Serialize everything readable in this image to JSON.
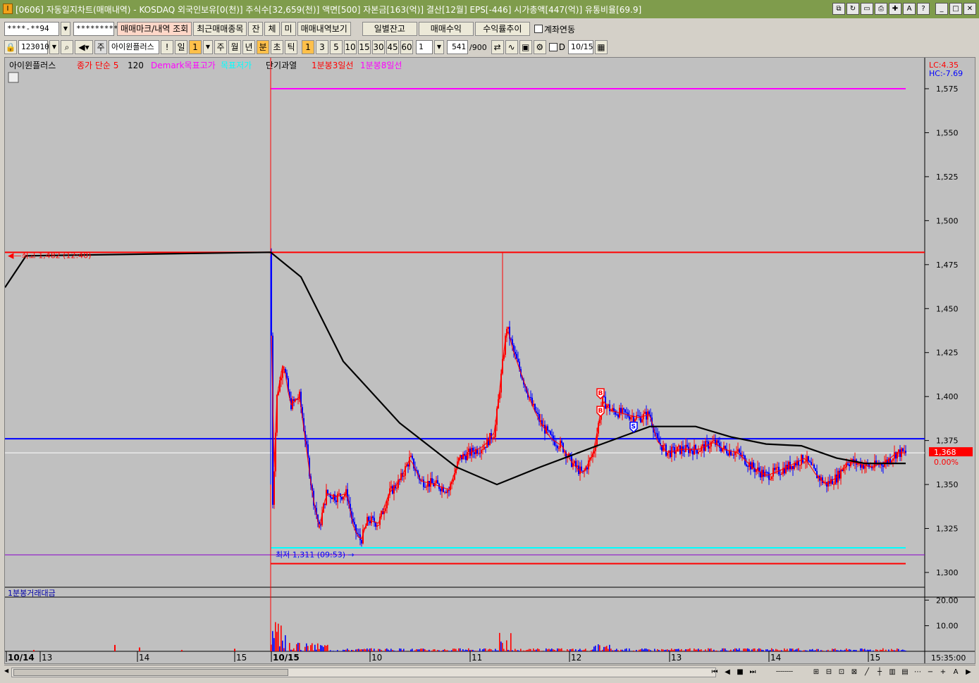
{
  "window": {
    "title": "[0606] 자동일지차트(매매내역) - KOSDAQ 외국인보유[0(천)] 주식수[32,659(천)] 액면[500] 자본금[163(억)] 결산[12월] EPS[-446] 시가총액[447(억)] 유통비율[69.9]",
    "app_icon_label": "I"
  },
  "toolbar1": {
    "account_value": "****-**94",
    "password_value": "*********",
    "buttons": [
      "매매마크/내역 조회",
      "최근매매종목",
      "잔",
      "체",
      "미",
      "매매내역보기"
    ],
    "right_buttons": [
      "일별잔고",
      "매매수익",
      "수익률추이"
    ],
    "link_checkbox_label": "계좌연동"
  },
  "toolbar2": {
    "code_value": "123010",
    "stock_name": "아이윈플러스",
    "stock_prefix": "주",
    "period_buttons": [
      "일",
      "1",
      "주",
      "월",
      "년",
      "분",
      "초",
      "틱"
    ],
    "minute_buttons": [
      "1",
      "3",
      "5",
      "10",
      "15",
      "30",
      "45",
      "60"
    ],
    "interval_value": "1",
    "count_value": "541",
    "count_total": "/900",
    "d_label": "D",
    "date_value": "10/15"
  },
  "chart": {
    "legend": [
      {
        "text": "아이윈플러스",
        "color": "#000000"
      },
      {
        "text": "종가 단순 5",
        "color": "#ff0000"
      },
      {
        "text": "120",
        "color": "#000000"
      },
      {
        "text": "Demark목표고가",
        "color": "#ff00ff"
      },
      {
        "text": "목표저가",
        "color": "#00ffff"
      },
      {
        "text": "단기과열",
        "color": "#000000"
      },
      {
        "text": "1분봉3일선",
        "color": "#ff0000"
      },
      {
        "text": "1분봉8일선",
        "color": "#ff00ff"
      }
    ],
    "lc_label": "LC:4.35",
    "hc_label": "HC:-7.69",
    "price_ticks": [
      "1,575",
      "1,550",
      "1,525",
      "1,500",
      "1,475",
      "1,450",
      "1,425",
      "1,400",
      "1,375",
      "1,350",
      "1,325",
      "1,300"
    ],
    "current_price": "1,368",
    "current_change": "0.00%",
    "high_annotation": "최고 1,482 (12:40)",
    "low_annotation": "최저 1,311 (09:53)",
    "trade_marks": [
      "B",
      "B",
      "S"
    ],
    "volume_title": "1분봉거래대금",
    "volume_ticks": [
      "20.00",
      "10.00"
    ],
    "time_labels": [
      "10/14",
      "13",
      "14",
      "15",
      "10/15",
      "10",
      "11",
      "12",
      "13",
      "14",
      "15"
    ],
    "time_end": "15:35:00",
    "colors": {
      "up": "#ff0000",
      "down": "#0000ff",
      "ma120": "#000000",
      "demark_high": "#ff00ff",
      "demark_low": "#00ffff",
      "high_line": "#ff0000",
      "blue_level": "#0000ff",
      "purple_level": "#8800cc"
    }
  },
  "chart_data": {
    "type": "line",
    "title": "아이윈플러스",
    "series": [
      {
        "name": "120",
        "x": [
          "10/14 12:40",
          "10/15 09:01",
          "10/15 11:00",
          "10/15 12:30",
          "10/15 13:00",
          "10/15 15:20"
        ],
        "values": [
          1462,
          1482,
          1350,
          1374,
          1384,
          1362
        ]
      }
    ],
    "levels": {
      "demark_high": 1575,
      "demark_low": 1314,
      "high": 1482,
      "low": 1311,
      "current": 1368,
      "blue_line": 1376,
      "purple_line": 1310,
      "red_low": 1305
    },
    "ylim": [
      1290,
      1585
    ],
    "volume_ylim": [
      0,
      22
    ]
  }
}
